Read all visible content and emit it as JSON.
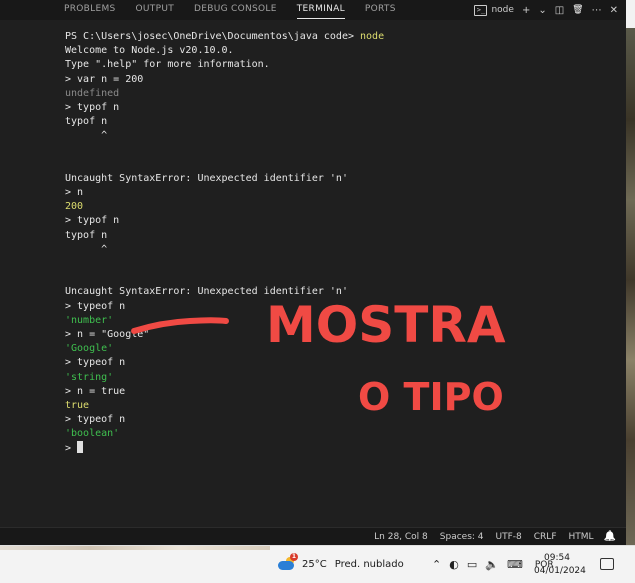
{
  "panel": {
    "tabs": [
      {
        "label": "PROBLEMS",
        "active": false
      },
      {
        "label": "OUTPUT",
        "active": false
      },
      {
        "label": "DEBUG CONSOLE",
        "active": false
      },
      {
        "label": "TERMINAL",
        "active": true
      },
      {
        "label": "PORTS",
        "active": false
      }
    ],
    "actions": {
      "terminal_name": "node",
      "add_icon": "plus-icon",
      "dropdown_icon": "chevron-down-icon",
      "split_icon": "split-icon",
      "trash_icon": "trash-icon",
      "more_icon": "ellipsis-icon",
      "close_icon": "close-icon",
      "add_glyph": "+",
      "dropdown_glyph": "⌄",
      "split_glyph": "◫",
      "trash_glyph": "🗑",
      "more_glyph": "⋯",
      "close_glyph": "✕"
    }
  },
  "terminal": {
    "lines": [
      {
        "text": "PS C:\\Users\\josec\\OneDrive\\Documentos\\java code> ",
        "suffix": "node",
        "style": "bright",
        "suffix_style": "yellow"
      },
      {
        "text": "Welcome to Node.js v20.10.0.",
        "style": "bright"
      },
      {
        "text": "Type \".help\" for more information.",
        "style": "bright"
      },
      {
        "text": "> var n = 200",
        "style": "bright"
      },
      {
        "text": "undefined",
        "style": "gray"
      },
      {
        "text": "> typof n",
        "style": "bright"
      },
      {
        "text": "typof n",
        "style": "bright"
      },
      {
        "text": "      ^",
        "style": "bright"
      },
      {
        "text": "",
        "style": "bright"
      },
      {
        "text": "",
        "style": "bright"
      },
      {
        "text": "Uncaught SyntaxError: Unexpected identifier 'n'",
        "style": "bright"
      },
      {
        "text": "> n",
        "style": "bright"
      },
      {
        "text": "200",
        "style": "yellow"
      },
      {
        "text": "> typof n",
        "style": "bright"
      },
      {
        "text": "typof n",
        "style": "bright"
      },
      {
        "text": "      ^",
        "style": "bright"
      },
      {
        "text": "",
        "style": "bright"
      },
      {
        "text": "",
        "style": "bright"
      },
      {
        "text": "Uncaught SyntaxError: Unexpected identifier 'n'",
        "style": "bright"
      },
      {
        "text": "> typeof n",
        "style": "bright"
      },
      {
        "text": "'number'",
        "style": "green"
      },
      {
        "text": "> n = \"Google\"",
        "style": "bright"
      },
      {
        "text": "'Google'",
        "style": "green"
      },
      {
        "text": "> typeof n",
        "style": "bright"
      },
      {
        "text": "'string'",
        "style": "green"
      },
      {
        "text": "> n = true",
        "style": "bright"
      },
      {
        "text": "true",
        "style": "yellow"
      },
      {
        "text": "> typeof n",
        "style": "bright"
      },
      {
        "text": "'boolean'",
        "style": "green"
      },
      {
        "text": "> ",
        "style": "bright",
        "cursor": true
      }
    ]
  },
  "annotation": {
    "line1": "MOSTRA",
    "line2": "O TIPO",
    "color": "#f04a44"
  },
  "status_bar": {
    "position": "Ln 28, Col 8",
    "spaces": "Spaces: 4",
    "encoding": "UTF-8",
    "eol": "CRLF",
    "language": "HTML",
    "bell_icon": "bell-icon",
    "bell_glyph": "🔔"
  },
  "taskbar": {
    "weather_temp": "25°C",
    "weather_cond": "Pred. nublado",
    "weather_badge": "1",
    "tray_icons": [
      {
        "name": "chevron-up-icon",
        "glyph": "⌃"
      },
      {
        "name": "meet-icon",
        "glyph": "◐"
      },
      {
        "name": "network-icon",
        "glyph": "▭"
      },
      {
        "name": "volume-icon",
        "glyph": "🔈"
      },
      {
        "name": "keyboard-icon",
        "glyph": "⌨"
      }
    ],
    "lang": "POR",
    "time": "09:54",
    "date": "04/01/2024",
    "notification_icon": "notification-icon"
  }
}
